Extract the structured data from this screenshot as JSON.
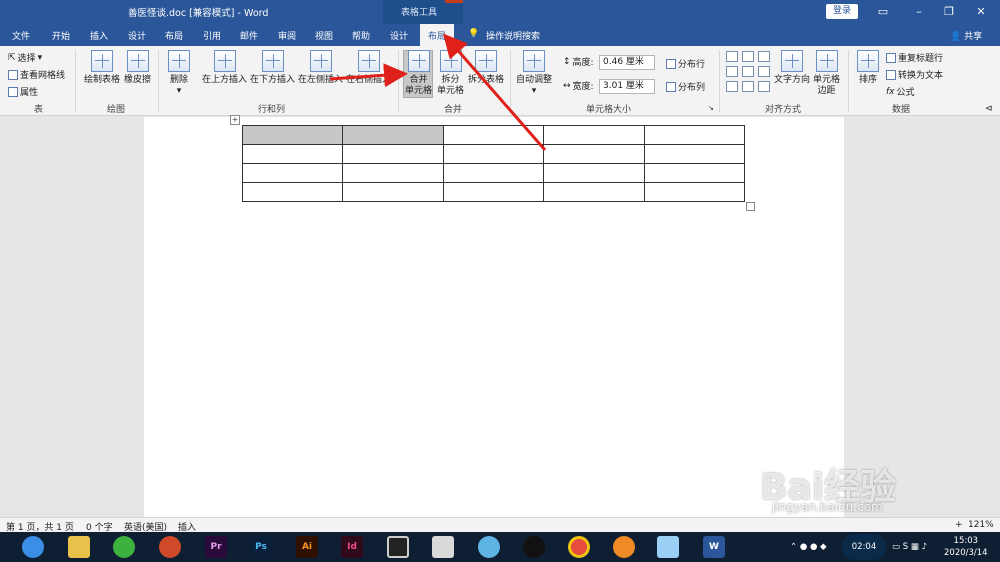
{
  "window": {
    "title": "善医怪谈.doc [兼容模式]  -  Word",
    "contextual_tab_group": "表格工具",
    "login": "登录"
  },
  "tabs": [
    "文件",
    "开始",
    "插入",
    "设计",
    "布局",
    "引用",
    "邮件",
    "审阅",
    "视图",
    "帮助",
    "设计",
    "布局"
  ],
  "tell_me": "操作说明搜索",
  "share": "共享",
  "ribbon": {
    "table_group": {
      "label": "表",
      "items": [
        "选择",
        "查看网格线",
        "属性"
      ]
    },
    "draw_group": {
      "label": "绘图",
      "items": [
        "绘制表格",
        "橡皮擦"
      ]
    },
    "rows_cols_group": {
      "label": "行和列",
      "items": [
        "删除",
        "在上方插入",
        "在下方插入",
        "在左侧插入",
        "在右侧插入"
      ]
    },
    "merge_group": {
      "label": "合并",
      "merge_top": "合并",
      "merge_bottom": "单元格",
      "split_top": "拆分",
      "split_bottom": "单元格",
      "split_table": "拆分表格"
    },
    "cell_size_group": {
      "label": "单元格大小",
      "auto_fit": "自动调整",
      "height_label": "高度:",
      "height_value": "0.46 厘米",
      "width_label": "宽度:",
      "width_value": "3.01 厘米",
      "distribute_rows": "分布行",
      "distribute_cols": "分布列"
    },
    "alignment_group": {
      "label": "对齐方式",
      "text_direction": "文字方向",
      "cell_margins_top": "单元格",
      "cell_margins_bottom": "边距"
    },
    "data_group": {
      "label": "数据",
      "sort": "排序",
      "repeat_header": "重复标题行",
      "convert_text": "转换为文本",
      "formula": "公式",
      "fx": "fx"
    }
  },
  "status": {
    "page": "第 1 页，共 1 页",
    "words": "0 个字",
    "lang": "英语(美国)",
    "mode": "插入",
    "zoom": "121%"
  },
  "taskbar": {
    "apps": [
      "Pr",
      "Ps",
      "Ai",
      "Id",
      "W"
    ],
    "time": "15:03",
    "date": "2020/3/14",
    "badge_time": "02:04"
  },
  "watermark": {
    "text": "Bai经验",
    "url": "jingyan.baidu.com"
  },
  "accent_color": "#2b579a",
  "arrow_color": "#e0201a"
}
